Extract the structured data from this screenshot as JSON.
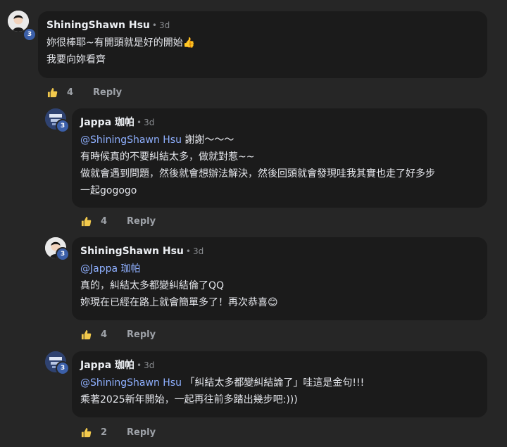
{
  "comments": [
    {
      "author": "ShiningShawn Hsu",
      "level": "3",
      "time": "3d",
      "mention": "",
      "lines": [
        "妳很棒耶~有開頭就是好的開始👍",
        "我要向妳看齊"
      ],
      "likes": "4",
      "reply_label": "Reply",
      "avatar_icon": "person-avatar-icon"
    },
    {
      "author": "Jappa 珈帕",
      "level": "3",
      "time": "3d",
      "mention": "@ShiningShawn Hsu",
      "lines": [
        "謝謝～～～",
        "有時候真的不要糾結太多，做就對惹~~",
        "做就會遇到問題，然後就會想辦法解決，然後回頭就會發現哇我其實也走了好多步",
        "一起gogogo"
      ],
      "likes": "4",
      "reply_label": "Reply",
      "avatar_icon": "jappa-logo-avatar-icon"
    },
    {
      "author": "ShiningShawn Hsu",
      "level": "3",
      "time": "3d",
      "mention": "@Jappa 珈帕",
      "lines": [
        "",
        "真的，糾結太多都變糾結倫了QQ",
        "妳現在已經在路上就會簡單多了！再次恭喜😊"
      ],
      "likes": "4",
      "reply_label": "Reply",
      "avatar_icon": "person-avatar-icon"
    },
    {
      "author": "Jappa 珈帕",
      "level": "3",
      "time": "3d",
      "mention": "@ShiningShawn Hsu",
      "lines": [
        "「糾結太多都變糾結論了」哇這是金句!!!",
        "乘著2025新年開始，一起再往前多踏出幾步吧:)))"
      ],
      "likes": "2",
      "reply_label": "Reply",
      "avatar_icon": "jappa-logo-avatar-icon"
    }
  ],
  "colors": {
    "background": "#262626",
    "bubble": "#1b1b1b",
    "mention": "#8fb0ff",
    "badge": "#3b5fa8",
    "muted": "#9ea2a8"
  }
}
